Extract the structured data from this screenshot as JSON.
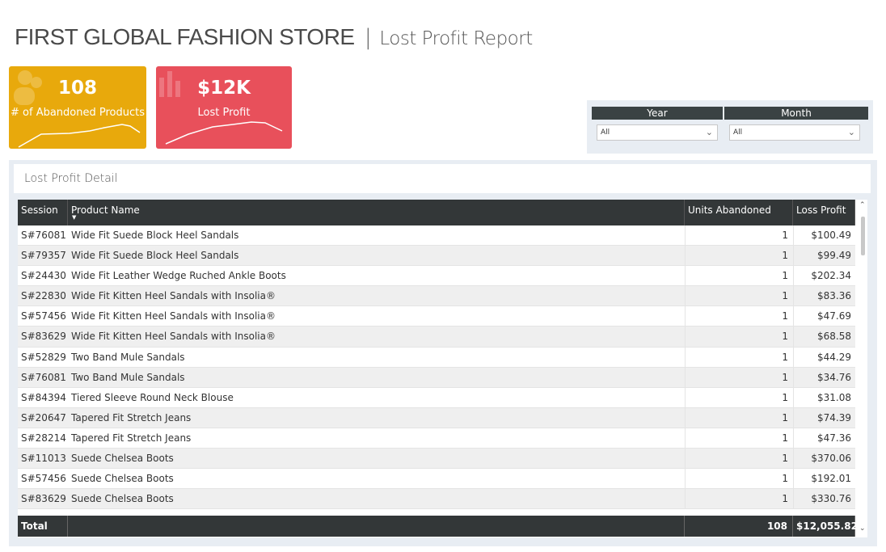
{
  "header": {
    "store_name": "FIRST GLOBAL FASHION STORE",
    "separator": "|",
    "report_name": "Lost Profit Report"
  },
  "kpis": [
    {
      "value": "108",
      "label": "# of Abandoned Products",
      "color": "#e8a90c",
      "icon": "people-icon"
    },
    {
      "value": "$12K",
      "label": "Lost Profit",
      "color": "#e8505b",
      "icon": "bar-chart-icon"
    }
  ],
  "slicers": {
    "year": {
      "label": "Year",
      "selected": "All"
    },
    "month": {
      "label": "Month",
      "selected": "All"
    }
  },
  "detail": {
    "title": "Lost Profit Detail",
    "columns": [
      "Session ID",
      "Product Name",
      "Units Abandoned",
      "Loss Profit ($)"
    ],
    "rows": [
      {
        "session": "S#76081",
        "product": "Wide Fit Suede Block Heel Sandals",
        "units": "1",
        "loss": "$100.49"
      },
      {
        "session": "S#79357",
        "product": "Wide Fit Suede Block Heel Sandals",
        "units": "1",
        "loss": "$99.49"
      },
      {
        "session": "S#24430",
        "product": "Wide Fit Leather Wedge Ruched Ankle Boots",
        "units": "1",
        "loss": "$202.34"
      },
      {
        "session": "S#22830",
        "product": "Wide Fit Kitten Heel Sandals with Insolia®",
        "units": "1",
        "loss": "$83.36"
      },
      {
        "session": "S#57456",
        "product": "Wide Fit Kitten Heel Sandals with Insolia®",
        "units": "1",
        "loss": "$47.69"
      },
      {
        "session": "S#83629",
        "product": "Wide Fit Kitten Heel Sandals with Insolia®",
        "units": "1",
        "loss": "$68.58"
      },
      {
        "session": "S#52829",
        "product": "Two Band Mule Sandals",
        "units": "1",
        "loss": "$44.29"
      },
      {
        "session": "S#76081",
        "product": "Two Band Mule Sandals",
        "units": "1",
        "loss": "$34.76"
      },
      {
        "session": "S#84394",
        "product": "Tiered Sleeve Round Neck Blouse",
        "units": "1",
        "loss": "$31.08"
      },
      {
        "session": "S#20647",
        "product": "Tapered Fit Stretch Jeans",
        "units": "1",
        "loss": "$74.39"
      },
      {
        "session": "S#28214",
        "product": "Tapered Fit Stretch Jeans",
        "units": "1",
        "loss": "$47.36"
      },
      {
        "session": "S#11013",
        "product": "Suede Chelsea Boots",
        "units": "1",
        "loss": "$370.06"
      },
      {
        "session": "S#57456",
        "product": "Suede Chelsea Boots",
        "units": "1",
        "loss": "$192.01"
      },
      {
        "session": "S#83629",
        "product": "Suede Chelsea Boots",
        "units": "1",
        "loss": "$330.76"
      }
    ],
    "total": {
      "label": "Total",
      "units": "108",
      "loss": "$12,055.82"
    }
  }
}
